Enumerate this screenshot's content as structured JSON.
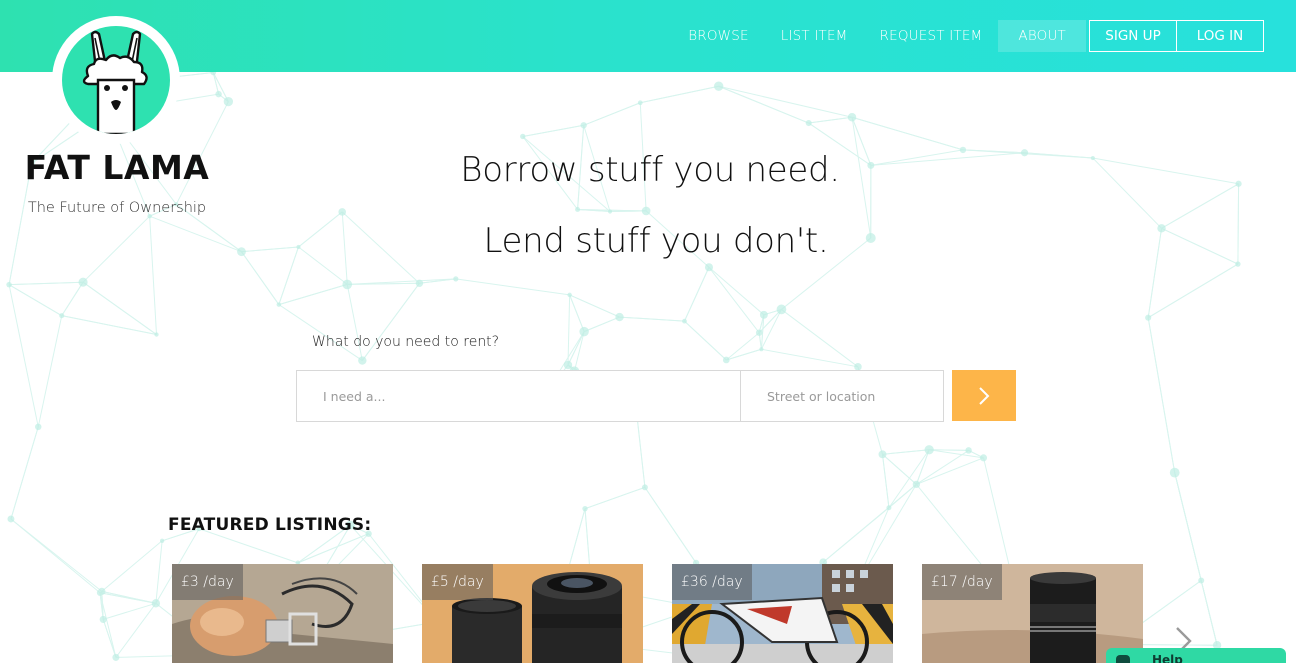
{
  "brand": {
    "name": "FAT LAMA",
    "tagline": "The Future of Ownership",
    "accent": "#2ee1b0",
    "cta_color": "#fdb549"
  },
  "nav": {
    "browse": "BROWSE",
    "list_item": "LIST ITEM",
    "request_item": "REQUEST ITEM",
    "about": "ABOUT",
    "sign_up": "SIGN UP",
    "log_in": "LOG IN"
  },
  "hero": {
    "line1": "Borrow stuff you need.",
    "line2": "Lend stuff you don't."
  },
  "search": {
    "label": "What do you need to rent?",
    "need_placeholder": "I need a...",
    "need_value": "",
    "location_placeholder": "Street or location",
    "location_value": "",
    "submit_icon": "chevron-right-icon"
  },
  "featured": {
    "title": "FEATURED LISTINGS:",
    "listings": [
      {
        "price": "£3 /day",
        "image": "cable-tool-photo"
      },
      {
        "price": "£5 /day",
        "image": "camera-lens-photo"
      },
      {
        "price": "£36 /day",
        "image": "electric-bike-photo"
      },
      {
        "price": "£17 /day",
        "image": "prime-lens-photo"
      }
    ],
    "next_icon": "chevron-right-icon"
  },
  "help": {
    "label": "Help"
  }
}
